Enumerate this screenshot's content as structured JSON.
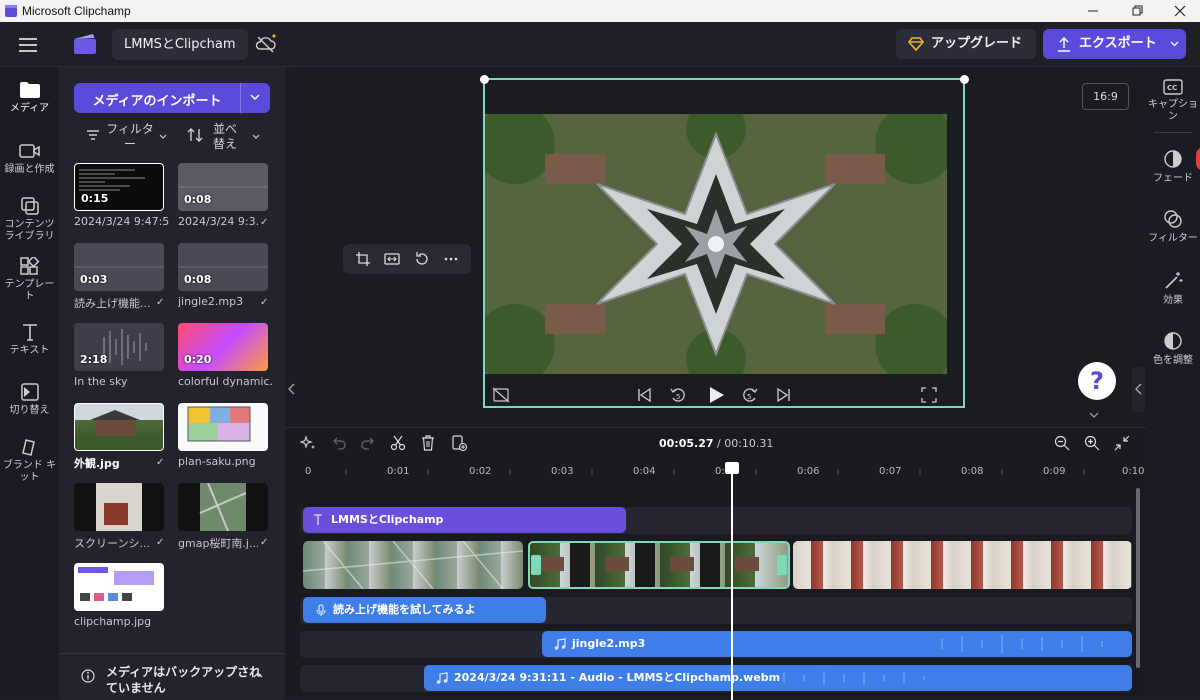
{
  "window": {
    "title": "Microsoft Clipchamp"
  },
  "header": {
    "project_name": "LMMSとClipcham",
    "upgrade_label": "アップグレード",
    "export_label": "エクスポート"
  },
  "left_rail": [
    {
      "label": "メディア"
    },
    {
      "label": "録画と作成"
    },
    {
      "label": "コンテンツ ライブラリ"
    },
    {
      "label": "テンプレート"
    },
    {
      "label": "テキスト"
    },
    {
      "label": "切り替え"
    },
    {
      "label": "ブランド キット"
    }
  ],
  "media_panel": {
    "import_label": "メディアのインポート",
    "filter_label": "フィルター",
    "sort_label": "並べ替え",
    "items": [
      {
        "label": "2024/3/24 9:47:5...",
        "duration": "0:15",
        "check": ""
      },
      {
        "label": "2024/3/24 9:3...",
        "duration": "0:08",
        "check": "✓"
      },
      {
        "label": "読み上げ機能...",
        "duration": "0:03",
        "check": "✓"
      },
      {
        "label": "jingle2.mp3",
        "duration": "0:08",
        "check": "✓"
      },
      {
        "label": "In the sky",
        "duration": "2:18",
        "check": ""
      },
      {
        "label": "colorful dynamic...",
        "duration": "0:20",
        "check": ""
      },
      {
        "label": "外観.jpg",
        "duration": "",
        "check": "✓"
      },
      {
        "label": "plan-saku.png",
        "duration": "",
        "check": ""
      },
      {
        "label": "スクリーンシ...",
        "duration": "",
        "check": "✓"
      },
      {
        "label": "gmap桜町南.j...",
        "duration": "",
        "check": "✓"
      },
      {
        "label": "clipchamp.jpg",
        "duration": "",
        "check": ""
      }
    ],
    "backup_notice": "メディアはバックアップされていません"
  },
  "preview": {
    "aspect_ratio": "16:9",
    "help": "?"
  },
  "right_rail": [
    {
      "label": "キャプション"
    },
    {
      "label": "フェード"
    },
    {
      "label": "フィルター"
    },
    {
      "label": "効果"
    },
    {
      "label": "色を調整"
    }
  ],
  "timeline": {
    "current_time": "00:05.27",
    "total_time": "/ 00:10.31",
    "ruler_ticks": [
      "0",
      "0:01",
      "0:02",
      "0:03",
      "0:04",
      "0:05",
      "0:06",
      "0:07",
      "0:08",
      "0:09",
      "0:10"
    ],
    "text_clip": "LMMSとClipchamp",
    "voice_clip": "読み上げ機能を試してみるよ",
    "audio_clip_1": "jingle2.mp3",
    "audio_clip_2": "2024/3/24 9:31:11 - Audio - LMMSとClipchamp.webm"
  },
  "colors": {
    "accent": "#5b4bdb",
    "selection": "#7fd9b8",
    "audio_clip": "#3f7ee8"
  }
}
